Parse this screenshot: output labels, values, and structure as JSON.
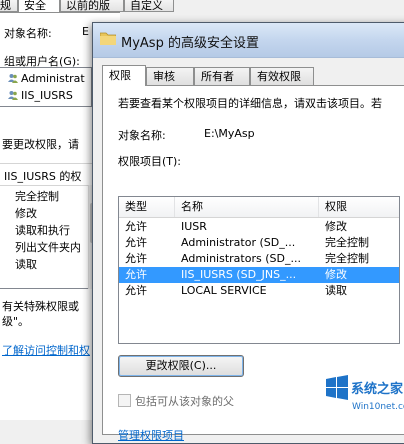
{
  "background_window": {
    "tabs": [
      "规",
      "安全",
      "以前的版本",
      "自定义"
    ],
    "object_name_label": "对象名称:",
    "object_name_value": "E",
    "groups_label": "组或用户名(G):",
    "users": [
      "Administrat",
      "IIS_IUSRS"
    ],
    "change_perm_text": "要更改权限，请",
    "perm_for_label": "IIS_IUSRS 的权",
    "permissions": [
      "完全控制",
      "修改",
      "读取和执行",
      "列出文件夹内",
      "读取"
    ],
    "special_text_1": "有关特殊权限或",
    "special_text_2": "级\"。",
    "learn_link": "了解访问控制和权"
  },
  "dialog": {
    "title": "MyAsp 的高级安全设置",
    "tabs": [
      "权限",
      "审核",
      "所有者",
      "有效权限"
    ],
    "info_text": "若要查看某个权限项目的详细信息，请双击该项目。若",
    "object_name_label": "对象名称:",
    "object_name_value": "E:\\MyAsp",
    "entries_label": "权限项目(T):",
    "columns": {
      "type": "类型",
      "name": "名称",
      "permission": "权限"
    },
    "entries": [
      {
        "type": "允许",
        "name": "IUSR",
        "permission": "修改"
      },
      {
        "type": "允许",
        "name": "Administrator (SD_...",
        "permission": "完全控制"
      },
      {
        "type": "允许",
        "name": "Administrators (SD_...",
        "permission": "完全控制"
      },
      {
        "type": "允许",
        "name": "IIS_IUSRS (SD_JNS_...",
        "permission": "修改"
      },
      {
        "type": "允许",
        "name": "LOCAL SERVICE",
        "permission": "读取"
      }
    ],
    "selected_entry_index": 3,
    "change_button": "更改权限(C)...",
    "inherit_checkbox": "包括可从该对象的父",
    "manage_link": "管理权限项目"
  },
  "watermark": {
    "brand": "系统之家",
    "site": "Win10net.com"
  },
  "colors": {
    "selection": "#3399ff",
    "link": "#0066cc",
    "titlebar": "#c4d6ee"
  }
}
